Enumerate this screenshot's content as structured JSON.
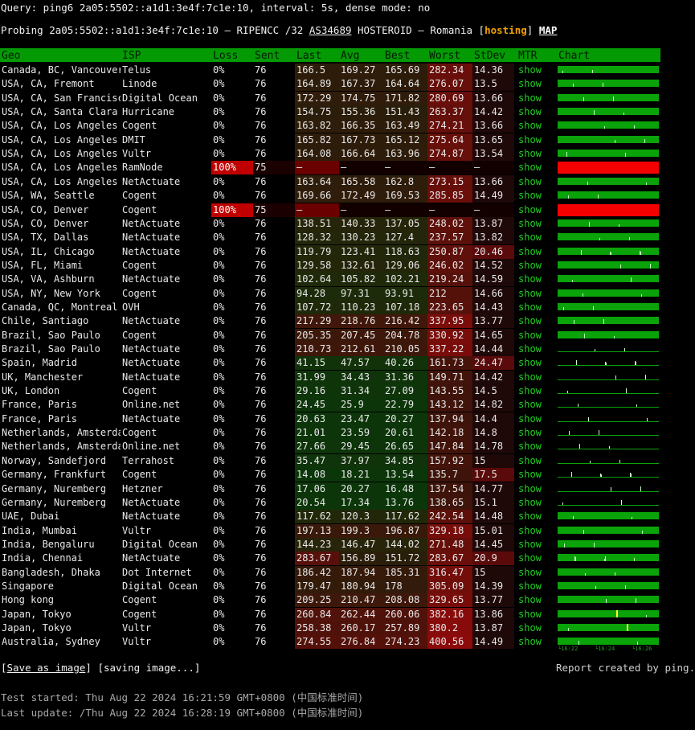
{
  "query_line": "Query: ping6 2a05:5502::a1d1:3e4f:7c1e:10, interval: 5s, dense mode: no",
  "probe": {
    "prefix": "Probing 2a05:5502::a1d1:3e4f:7c1e:10 – RIPENCC /32 ",
    "asn": "AS34689",
    "mid": " HOSTEROID – Romania [",
    "hosting": "hosting",
    "close": "] ",
    "map": "MAP"
  },
  "headers": [
    "Geo",
    "ISP",
    "Loss",
    "Sent",
    "Last",
    "Avg",
    "Best",
    "Worst",
    "StDev",
    "MTR",
    "Chart"
  ],
  "mtr_label": "show",
  "colors": {
    "header_bg": "#049a04",
    "mtr_link": "#1fd11f",
    "loss_bad": "#c00000",
    "hosting": "#f0a000"
  },
  "rows": [
    {
      "geo": "Canada, BC, Vancouver",
      "isp": "Telus",
      "loss": "0%",
      "sent": "76",
      "last": "166.5",
      "avg": "169.27",
      "best": "165.69",
      "worst": "282.34",
      "stdev": "14.36"
    },
    {
      "geo": "USA, CA, Fremont",
      "isp": "Linode",
      "loss": "0%",
      "sent": "76",
      "last": "164.89",
      "avg": "167.37",
      "best": "164.64",
      "worst": "276.07",
      "stdev": "13.5"
    },
    {
      "geo": "USA, CA, San Francisco",
      "isp": "Digital Ocean",
      "loss": "0%",
      "sent": "76",
      "last": "172.29",
      "avg": "174.75",
      "best": "171.82",
      "worst": "280.69",
      "stdev": "13.66"
    },
    {
      "geo": "USA, CA, Santa Clara",
      "isp": "Hurricane",
      "loss": "0%",
      "sent": "76",
      "last": "154.75",
      "avg": "155.36",
      "best": "151.43",
      "worst": "263.37",
      "stdev": "14.42"
    },
    {
      "geo": "USA, CA, Los Angeles",
      "isp": "Cogent",
      "loss": "0%",
      "sent": "76",
      "last": "163.82",
      "avg": "166.35",
      "best": "163.49",
      "worst": "274.21",
      "stdev": "13.66"
    },
    {
      "geo": "USA, CA, Los Angeles",
      "isp": "DMIT",
      "loss": "0%",
      "sent": "76",
      "last": "165.82",
      "avg": "167.73",
      "best": "165.12",
      "worst": "275.64",
      "stdev": "13.65"
    },
    {
      "geo": "USA, CA, Los Angeles",
      "isp": "Vultr",
      "loss": "0%",
      "sent": "76",
      "last": "164.08",
      "avg": "166.64",
      "best": "163.96",
      "worst": "274.87",
      "stdev": "13.54"
    },
    {
      "geo": "USA, CA, Los Angeles",
      "isp": "RamNode",
      "loss": "100%",
      "sent": "75",
      "last": "–",
      "avg": "–",
      "best": "–",
      "worst": "–",
      "stdev": "–",
      "fail": true
    },
    {
      "geo": "USA, CA, Los Angeles",
      "isp": "NetActuate",
      "loss": "0%",
      "sent": "76",
      "last": "163.64",
      "avg": "165.58",
      "best": "162.8",
      "worst": "273.15",
      "stdev": "13.66"
    },
    {
      "geo": "USA, WA, Seattle",
      "isp": "Cogent",
      "loss": "0%",
      "sent": "76",
      "last": "169.66",
      "avg": "172.49",
      "best": "169.53",
      "worst": "285.85",
      "stdev": "14.49"
    },
    {
      "geo": "USA, CO, Denver",
      "isp": "Cogent",
      "loss": "100%",
      "sent": "75",
      "last": "–",
      "avg": "–",
      "best": "–",
      "worst": "–",
      "stdev": "–",
      "fail": true
    },
    {
      "geo": "USA, CO, Denver",
      "isp": "NetActuate",
      "loss": "0%",
      "sent": "76",
      "last": "138.51",
      "avg": "140.33",
      "best": "137.05",
      "worst": "248.02",
      "stdev": "13.87"
    },
    {
      "geo": "USA, TX, Dallas",
      "isp": "NetActuate",
      "loss": "0%",
      "sent": "76",
      "last": "128.32",
      "avg": "130.23",
      "best": "127.4",
      "worst": "237.57",
      "stdev": "13.82"
    },
    {
      "geo": "USA, IL, Chicago",
      "isp": "NetActuate",
      "loss": "0%",
      "sent": "76",
      "last": "119.79",
      "avg": "123.41",
      "best": "118.63",
      "worst": "250.87",
      "stdev": "20.46"
    },
    {
      "geo": "USA, FL, Miami",
      "isp": "Cogent",
      "loss": "0%",
      "sent": "76",
      "last": "129.58",
      "avg": "132.61",
      "best": "129.06",
      "worst": "246.02",
      "stdev": "14.52"
    },
    {
      "geo": "USA, VA, Ashburn",
      "isp": "NetActuate",
      "loss": "0%",
      "sent": "76",
      "last": "102.64",
      "avg": "105.82",
      "best": "102.21",
      "worst": "219.24",
      "stdev": "14.59"
    },
    {
      "geo": "USA, NY, New York",
      "isp": "Cogent",
      "loss": "0%",
      "sent": "76",
      "last": "94.28",
      "avg": "97.31",
      "best": "93.91",
      "worst": "212",
      "stdev": "14.66"
    },
    {
      "geo": "Canada, QC, Montreal",
      "isp": "OVH",
      "loss": "0%",
      "sent": "76",
      "last": "107.72",
      "avg": "110.23",
      "best": "107.18",
      "worst": "223.65",
      "stdev": "14.43"
    },
    {
      "geo": "Chile, Santiago",
      "isp": "NetActuate",
      "loss": "0%",
      "sent": "76",
      "last": "217.29",
      "avg": "218.76",
      "best": "216.42",
      "worst": "337.95",
      "stdev": "13.77"
    },
    {
      "geo": "Brazil, Sao Paulo",
      "isp": "Cogent",
      "loss": "0%",
      "sent": "76",
      "last": "205.35",
      "avg": "207.45",
      "best": "204.78",
      "worst": "330.92",
      "stdev": "14.65"
    },
    {
      "geo": "Brazil, Sao Paulo",
      "isp": "NetActuate",
      "loss": "0%",
      "sent": "76",
      "last": "210.73",
      "avg": "212.61",
      "best": "210.05",
      "worst": "337.22",
      "stdev": "14.44"
    },
    {
      "geo": "Spain, Madrid",
      "isp": "NetActuate",
      "loss": "0%",
      "sent": "76",
      "last": "41.15",
      "avg": "47.57",
      "best": "40.26",
      "worst": "161.73",
      "stdev": "24.47"
    },
    {
      "geo": "UK, Manchester",
      "isp": "NetActuate",
      "loss": "0%",
      "sent": "76",
      "last": "31.99",
      "avg": "34.43",
      "best": "31.36",
      "worst": "149.71",
      "stdev": "14.42"
    },
    {
      "geo": "UK, London",
      "isp": "Cogent",
      "loss": "0%",
      "sent": "76",
      "last": "29.16",
      "avg": "31.34",
      "best": "27.09",
      "worst": "143.55",
      "stdev": "14.5"
    },
    {
      "geo": "France, Paris",
      "isp": "Online.net",
      "loss": "0%",
      "sent": "76",
      "last": "24.45",
      "avg": "25.9",
      "best": "22.79",
      "worst": "143.12",
      "stdev": "14.82"
    },
    {
      "geo": "France, Paris",
      "isp": "NetActuate",
      "loss": "0%",
      "sent": "76",
      "last": "20.63",
      "avg": "23.47",
      "best": "20.27",
      "worst": "137.94",
      "stdev": "14.4"
    },
    {
      "geo": "Netherlands, Amsterdam",
      "isp": "Cogent",
      "loss": "0%",
      "sent": "76",
      "last": "21.01",
      "avg": "23.59",
      "best": "20.61",
      "worst": "142.18",
      "stdev": "14.8"
    },
    {
      "geo": "Netherlands, Amsterdam",
      "isp": "Online.net",
      "loss": "0%",
      "sent": "76",
      "last": "27.66",
      "avg": "29.45",
      "best": "26.65",
      "worst": "147.84",
      "stdev": "14.78"
    },
    {
      "geo": "Norway, Sandefjord",
      "isp": "Terrahost",
      "loss": "0%",
      "sent": "76",
      "last": "35.47",
      "avg": "37.97",
      "best": "34.85",
      "worst": "157.92",
      "stdev": "15"
    },
    {
      "geo": "Germany, Frankfurt",
      "isp": "Cogent",
      "loss": "0%",
      "sent": "76",
      "last": "14.08",
      "avg": "18.21",
      "best": "13.54",
      "worst": "135.7",
      "stdev": "17.5"
    },
    {
      "geo": "Germany, Nuremberg",
      "isp": "Hetzner",
      "loss": "0%",
      "sent": "76",
      "last": "17.06",
      "avg": "20.27",
      "best": "16.48",
      "worst": "137.54",
      "stdev": "14.77"
    },
    {
      "geo": "Germany, Nuremberg",
      "isp": "NetActuate",
      "loss": "0%",
      "sent": "76",
      "last": "20.54",
      "avg": "17.34",
      "best": "13.76",
      "worst": "138.65",
      "stdev": "15.1"
    },
    {
      "geo": "UAE, Dubai",
      "isp": "NetActuate",
      "loss": "0%",
      "sent": "76",
      "last": "117.62",
      "avg": "120.3",
      "best": "117.62",
      "worst": "242.54",
      "stdev": "14.48"
    },
    {
      "geo": "India, Mumbai",
      "isp": "Vultr",
      "loss": "0%",
      "sent": "76",
      "last": "197.13",
      "avg": "199.3",
      "best": "196.87",
      "worst": "329.18",
      "stdev": "15.01"
    },
    {
      "geo": "India, Bengaluru",
      "isp": "Digital Ocean",
      "loss": "0%",
      "sent": "76",
      "last": "144.23",
      "avg": "146.47",
      "best": "144.02",
      "worst": "271.48",
      "stdev": "14.45"
    },
    {
      "geo": "India, Chennai",
      "isp": "NetActuate",
      "loss": "0%",
      "sent": "76",
      "last": "283.67",
      "avg": "156.89",
      "best": "151.72",
      "worst": "283.67",
      "stdev": "20.9"
    },
    {
      "geo": "Bangladesh, Dhaka",
      "isp": "Dot Internet",
      "loss": "0%",
      "sent": "76",
      "last": "186.42",
      "avg": "187.94",
      "best": "185.31",
      "worst": "316.47",
      "stdev": "15"
    },
    {
      "geo": "Singapore",
      "isp": "Digital Ocean",
      "loss": "0%",
      "sent": "76",
      "last": "179.47",
      "avg": "180.94",
      "best": "178",
      "worst": "305.09",
      "stdev": "14.39"
    },
    {
      "geo": "Hong kong",
      "isp": "Cogent",
      "loss": "0%",
      "sent": "76",
      "last": "209.25",
      "avg": "210.47",
      "best": "208.08",
      "worst": "329.65",
      "stdev": "13.77"
    },
    {
      "geo": "Japan, Tokyo",
      "isp": "Cogent",
      "loss": "0%",
      "sent": "76",
      "last": "260.84",
      "avg": "262.44",
      "best": "260.06",
      "worst": "382.16",
      "stdev": "13.86"
    },
    {
      "geo": "Japan, Tokyo",
      "isp": "Vultr",
      "loss": "0%",
      "sent": "76",
      "last": "258.38",
      "avg": "260.17",
      "best": "257.89",
      "worst": "380.2",
      "stdev": "13.87"
    },
    {
      "geo": "Australia, Sydney",
      "isp": "Vultr",
      "loss": "0%",
      "sent": "76",
      "last": "274.55",
      "avg": "276.84",
      "best": "274.23",
      "worst": "400.56",
      "stdev": "14.49"
    }
  ],
  "chart_axis": [
    "16:22",
    "16:24",
    "16:26"
  ],
  "footer": {
    "save_link": "Save as image",
    "saving_status": "[saving image...]",
    "credit": "Report created by ping.pe",
    "started": "Test started: Thu Aug 22 2024 16:21:59 GMT+0800 (中国标准时间)",
    "updated": "Last update: /Thu Aug 22 2024 16:28:19 GMT+0800 (中国标准时间)"
  }
}
